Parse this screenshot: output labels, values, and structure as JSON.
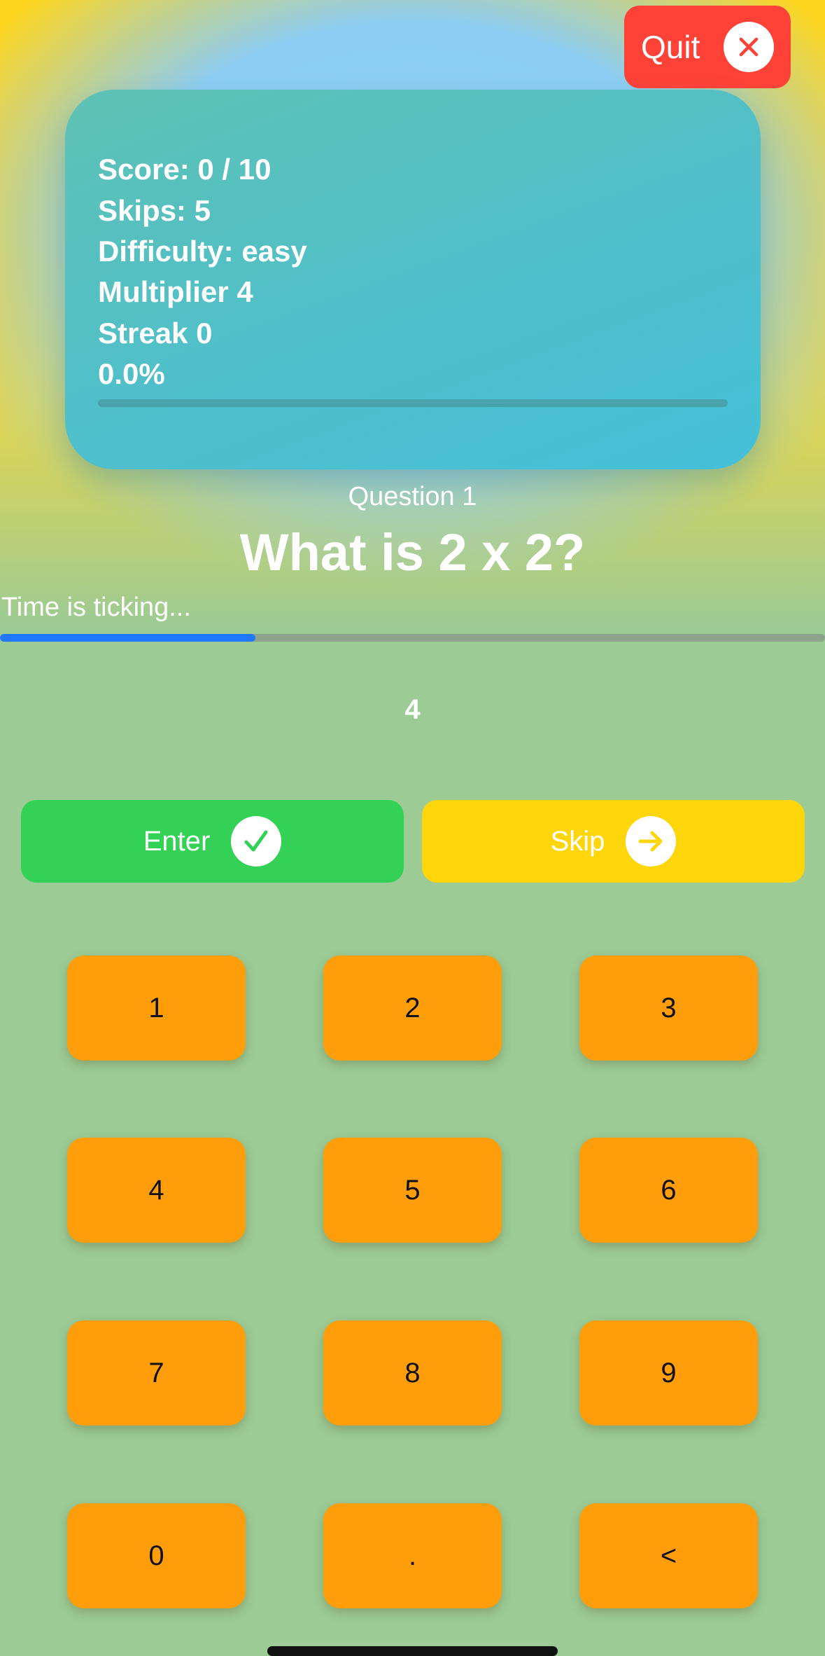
{
  "header": {
    "quit_label": "Quit",
    "quit_icon": "close-icon"
  },
  "stats": {
    "score": "Score: 0 / 10",
    "skips": "Skips: 5",
    "difficulty": "Difficulty: easy",
    "multiplier": "Multiplier 4",
    "streak": "Streak 0",
    "percent": "0.0%",
    "progress_fraction": 0.0
  },
  "question": {
    "number": "Question 1",
    "text": "What is 2 x 2?"
  },
  "timer": {
    "label": "Time is ticking...",
    "remaining_fraction": 0.31
  },
  "answer": {
    "value": "4"
  },
  "actions": {
    "enter_label": "Enter",
    "enter_icon": "checkmark-icon",
    "skip_label": "Skip",
    "skip_icon": "arrow-right-icon"
  },
  "keypad": {
    "keys": [
      "1",
      "2",
      "3",
      "4",
      "5",
      "6",
      "7",
      "8",
      "9",
      "0",
      ".",
      "<"
    ]
  },
  "colors": {
    "quit": "#ff4238",
    "card": "#4fbfcb",
    "enter": "#33d257",
    "skip": "#ffd60c",
    "key": "#ff9d0b",
    "timer_fill": "#1f78ff",
    "background": "#9ccb95"
  }
}
